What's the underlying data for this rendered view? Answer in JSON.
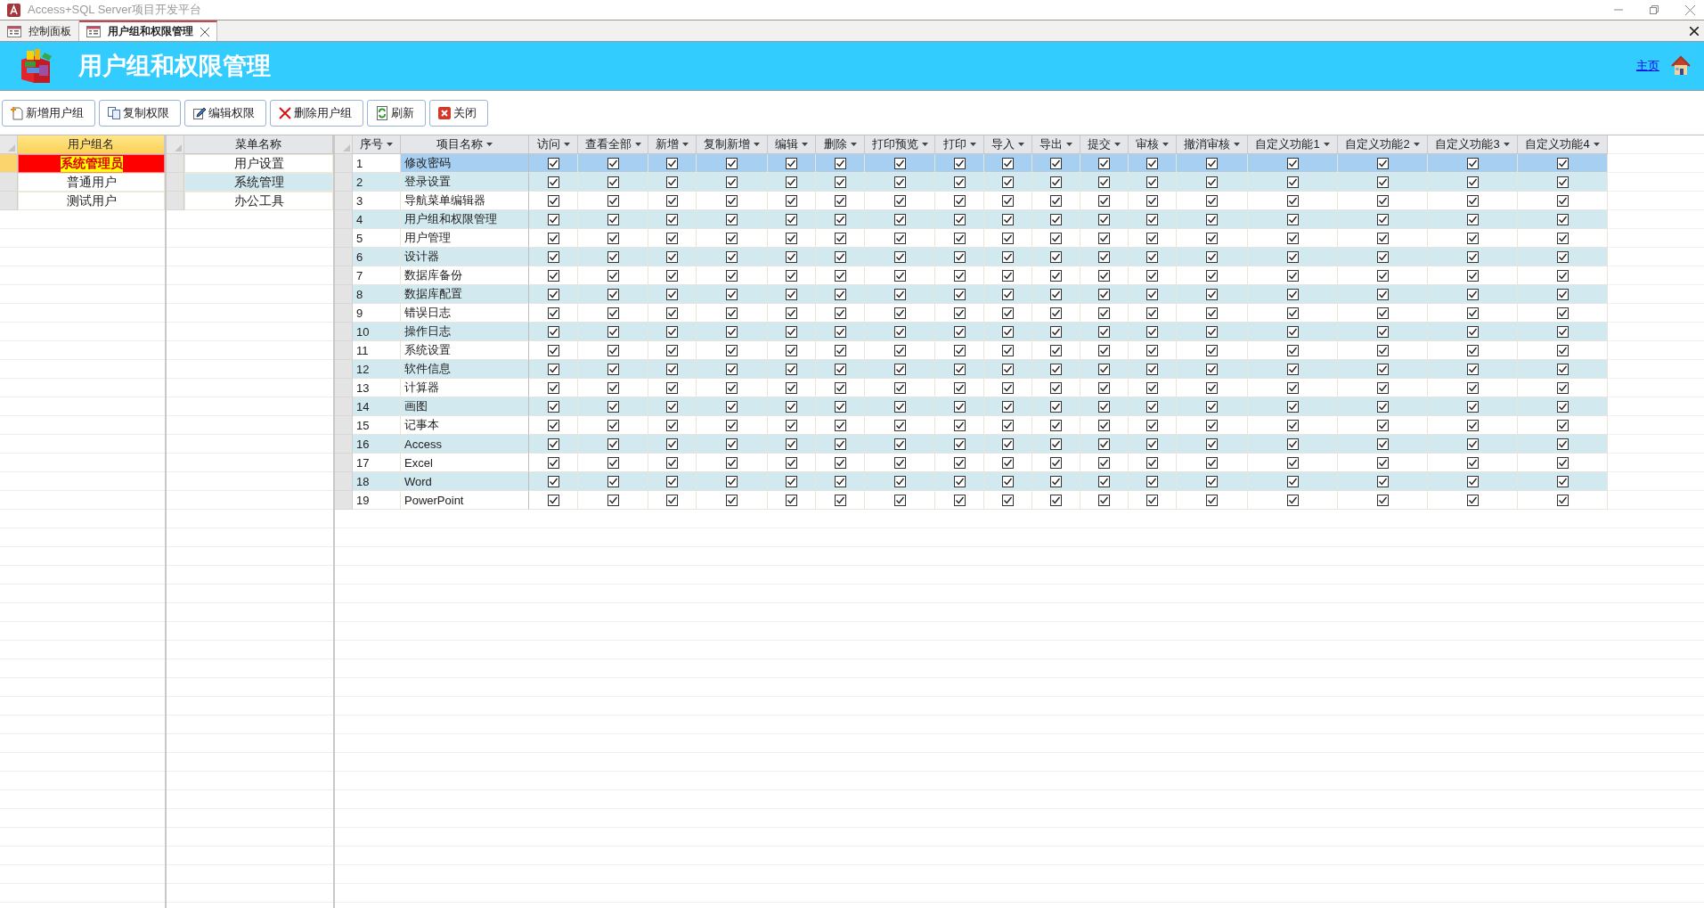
{
  "window": {
    "title": "Access+SQL Server项目开发平台"
  },
  "tabs": [
    {
      "label": "控制面板",
      "selected": false
    },
    {
      "label": "用户组和权限管理",
      "selected": true
    }
  ],
  "header": {
    "title": "用户组和权限管理",
    "home_link": "主页"
  },
  "toolbar": [
    {
      "kind": "add",
      "label": "新增用户组"
    },
    {
      "kind": "copy",
      "label": "复制权限"
    },
    {
      "kind": "edit",
      "label": "编辑权限"
    },
    {
      "kind": "delete",
      "label": "删除用户组"
    },
    {
      "kind": "refresh",
      "label": "刷新"
    },
    {
      "kind": "close",
      "label": "关闭"
    }
  ],
  "groups": {
    "column": "用户组名",
    "items": [
      {
        "label": "系统管理员",
        "selected": true
      },
      {
        "label": "普通用户",
        "selected": false
      },
      {
        "label": "测试用户",
        "selected": false
      }
    ]
  },
  "menus": {
    "column": "菜单名称",
    "items": [
      "用户设置",
      "系统管理",
      "办公工具"
    ]
  },
  "grid": {
    "columns": [
      "序号",
      "项目名称",
      "访问",
      "查看全部",
      "新增",
      "复制新增",
      "编辑",
      "删除",
      "打印预览",
      "打印",
      "导入",
      "导出",
      "提交",
      "审核",
      "撤消审核",
      "自定义功能1",
      "自定义功能2",
      "自定义功能3",
      "自定义功能4"
    ],
    "rows": [
      {
        "no": "1",
        "name": "修改密码",
        "selected": true,
        "perms": [
          true,
          true,
          true,
          true,
          true,
          true,
          true,
          true,
          true,
          true,
          true,
          true,
          true,
          true,
          true,
          true,
          true
        ]
      },
      {
        "no": "2",
        "name": "登录设置",
        "selected": false,
        "perms": [
          true,
          true,
          true,
          true,
          true,
          true,
          true,
          true,
          true,
          true,
          true,
          true,
          true,
          true,
          true,
          true,
          true
        ]
      },
      {
        "no": "3",
        "name": "导航菜单编辑器",
        "selected": false,
        "perms": [
          true,
          true,
          true,
          true,
          true,
          true,
          true,
          true,
          true,
          true,
          true,
          true,
          true,
          true,
          true,
          true,
          true
        ]
      },
      {
        "no": "4",
        "name": "用户组和权限管理",
        "selected": false,
        "perms": [
          true,
          true,
          true,
          true,
          true,
          true,
          true,
          true,
          true,
          true,
          true,
          true,
          true,
          true,
          true,
          true,
          true
        ]
      },
      {
        "no": "5",
        "name": "用户管理",
        "selected": false,
        "perms": [
          true,
          true,
          true,
          true,
          true,
          true,
          true,
          true,
          true,
          true,
          true,
          true,
          true,
          true,
          true,
          true,
          true
        ]
      },
      {
        "no": "6",
        "name": "设计器",
        "selected": false,
        "perms": [
          true,
          true,
          true,
          true,
          true,
          true,
          true,
          true,
          true,
          true,
          true,
          true,
          true,
          true,
          true,
          true,
          true
        ]
      },
      {
        "no": "7",
        "name": "数据库备份",
        "selected": false,
        "perms": [
          true,
          true,
          true,
          true,
          true,
          true,
          true,
          true,
          true,
          true,
          true,
          true,
          true,
          true,
          true,
          true,
          true
        ]
      },
      {
        "no": "8",
        "name": "数据库配置",
        "selected": false,
        "perms": [
          true,
          true,
          true,
          true,
          true,
          true,
          true,
          true,
          true,
          true,
          true,
          true,
          true,
          true,
          true,
          true,
          true
        ]
      },
      {
        "no": "9",
        "name": "错误日志",
        "selected": false,
        "perms": [
          true,
          true,
          true,
          true,
          true,
          true,
          true,
          true,
          true,
          true,
          true,
          true,
          true,
          true,
          true,
          true,
          true
        ]
      },
      {
        "no": "10",
        "name": "操作日志",
        "selected": false,
        "perms": [
          true,
          true,
          true,
          true,
          true,
          true,
          true,
          true,
          true,
          true,
          true,
          true,
          true,
          true,
          true,
          true,
          true
        ]
      },
      {
        "no": "11",
        "name": "系统设置",
        "selected": false,
        "perms": [
          true,
          true,
          true,
          true,
          true,
          true,
          true,
          true,
          true,
          true,
          true,
          true,
          true,
          true,
          true,
          true,
          true
        ]
      },
      {
        "no": "12",
        "name": "软件信息",
        "selected": false,
        "perms": [
          true,
          true,
          true,
          true,
          true,
          true,
          true,
          true,
          true,
          true,
          true,
          true,
          true,
          true,
          true,
          true,
          true
        ]
      },
      {
        "no": "13",
        "name": "计算器",
        "selected": false,
        "perms": [
          true,
          true,
          true,
          true,
          true,
          true,
          true,
          true,
          true,
          true,
          true,
          true,
          true,
          true,
          true,
          true,
          true
        ]
      },
      {
        "no": "14",
        "name": "画图",
        "selected": false,
        "perms": [
          true,
          true,
          true,
          true,
          true,
          true,
          true,
          true,
          true,
          true,
          true,
          true,
          true,
          true,
          true,
          true,
          true
        ]
      },
      {
        "no": "15",
        "name": "记事本",
        "selected": false,
        "perms": [
          true,
          true,
          true,
          true,
          true,
          true,
          true,
          true,
          true,
          true,
          true,
          true,
          true,
          true,
          true,
          true,
          true
        ]
      },
      {
        "no": "16",
        "name": "Access",
        "selected": false,
        "perms": [
          true,
          true,
          true,
          true,
          true,
          true,
          true,
          true,
          true,
          true,
          true,
          true,
          true,
          true,
          true,
          true,
          true
        ]
      },
      {
        "no": "17",
        "name": "Excel",
        "selected": false,
        "perms": [
          true,
          true,
          true,
          true,
          true,
          true,
          true,
          true,
          true,
          true,
          true,
          true,
          true,
          true,
          true,
          true,
          true
        ]
      },
      {
        "no": "18",
        "name": "Word",
        "selected": false,
        "perms": [
          true,
          true,
          true,
          true,
          true,
          true,
          true,
          true,
          true,
          true,
          true,
          true,
          true,
          true,
          true,
          true,
          true
        ]
      },
      {
        "no": "19",
        "name": "PowerPoint",
        "selected": false,
        "perms": [
          true,
          true,
          true,
          true,
          true,
          true,
          true,
          true,
          true,
          true,
          true,
          true,
          true,
          true,
          true,
          true,
          true
        ]
      }
    ]
  }
}
